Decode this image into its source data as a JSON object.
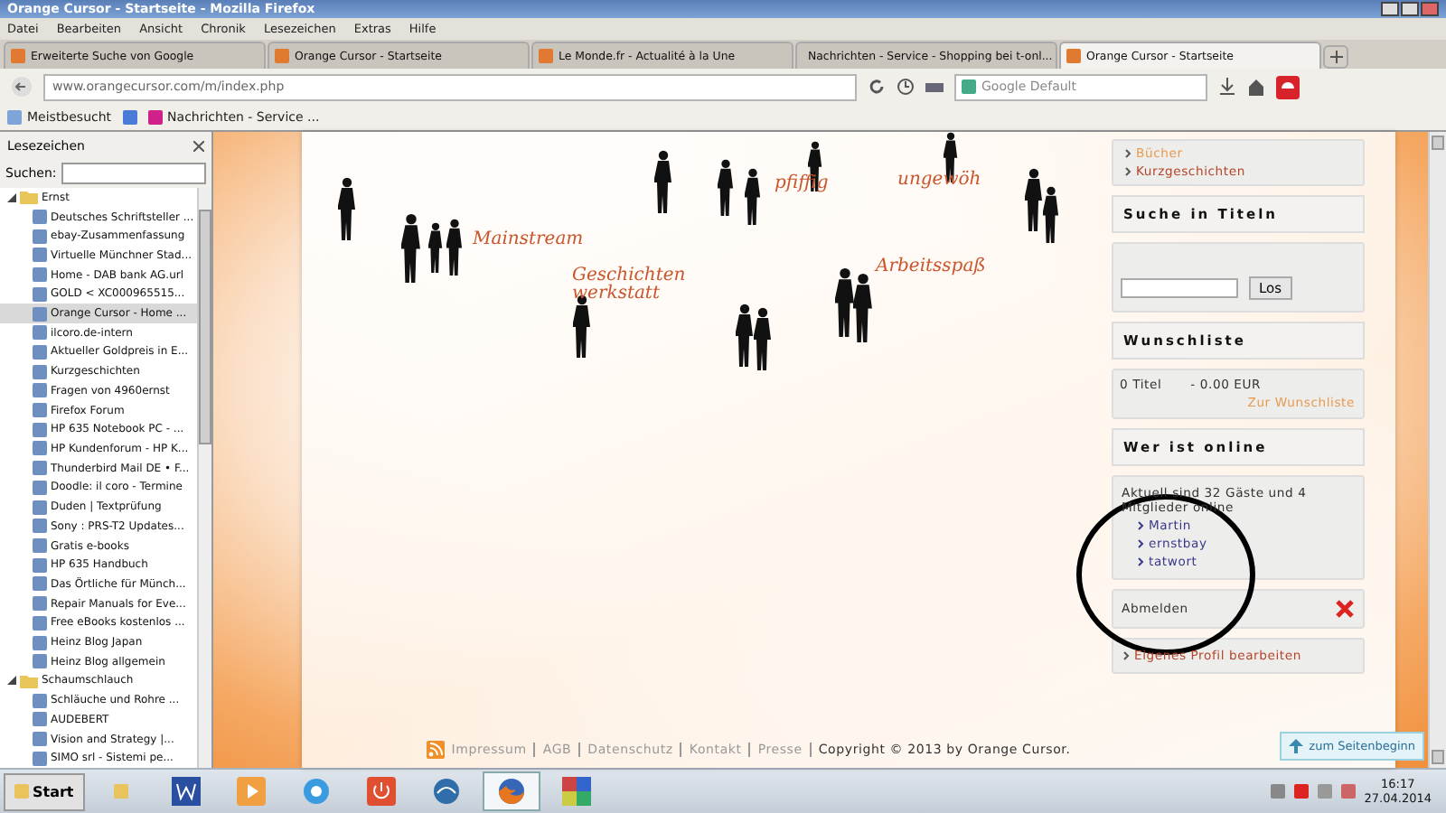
{
  "window": {
    "title": "Orange Cursor - Startseite - Mozilla Firefox"
  },
  "menu": [
    "Datei",
    "Bearbeiten",
    "Ansicht",
    "Chronik",
    "Lesezeichen",
    "Extras",
    "Hilfe"
  ],
  "tabs": [
    {
      "label": "Erweiterte Suche von Google",
      "selected": false
    },
    {
      "label": "Orange Cursor - Startseite",
      "selected": false
    },
    {
      "label": "Le Monde.fr - Actualité à la Une",
      "selected": false
    },
    {
      "label": "Nachrichten - Service - Shopping bei t-onl...",
      "selected": false
    },
    {
      "label": "Orange Cursor - Startseite",
      "selected": true
    }
  ],
  "address": {
    "url": "www.orangecursor.com/m/index.php"
  },
  "search": {
    "placeholder": "Google Default"
  },
  "bookmarks_bar": [
    "Meistbesucht",
    "Nachrichten - Service ..."
  ],
  "sidebar": {
    "title": "Lesezeichen",
    "search_label": "Suchen:",
    "tree": [
      {
        "label": "Ernst",
        "kind": "folder",
        "expanded": true,
        "selected": false,
        "children": [
          {
            "label": "Deutsches Schriftsteller ...",
            "kind": "link",
            "selected": false
          },
          {
            "label": "ebay-Zusammenfassung",
            "kind": "link",
            "selected": false
          },
          {
            "label": "Virtuelle Münchner Stad...",
            "kind": "link",
            "selected": false
          },
          {
            "label": "Home - DAB bank AG.url",
            "kind": "link",
            "selected": false
          },
          {
            "label": "GOLD < XC000965515...",
            "kind": "link",
            "selected": false
          },
          {
            "label": "Orange Cursor - Home ...",
            "kind": "link",
            "selected": true
          },
          {
            "label": "ilcoro.de-intern",
            "kind": "link",
            "selected": false
          },
          {
            "label": "Aktueller Goldpreis in E...",
            "kind": "link",
            "selected": false
          },
          {
            "label": "Kurzgeschichten",
            "kind": "link",
            "selected": false
          },
          {
            "label": "Fragen von 4960ernst",
            "kind": "link",
            "selected": false
          },
          {
            "label": "Firefox Forum",
            "kind": "link",
            "selected": false
          },
          {
            "label": "HP 635 Notebook PC - ...",
            "kind": "link",
            "selected": false
          },
          {
            "label": "HP Kundenforum - HP K...",
            "kind": "link",
            "selected": false
          },
          {
            "label": "Thunderbird Mail DE • F...",
            "kind": "link",
            "selected": false
          },
          {
            "label": "Doodle: il coro - Termine",
            "kind": "link",
            "selected": false
          },
          {
            "label": "Duden | Textprüfung",
            "kind": "link",
            "selected": false
          },
          {
            "label": "Sony : PRS-T2 Updates...",
            "kind": "link",
            "selected": false
          },
          {
            "label": "Gratis e-books",
            "kind": "link",
            "selected": false
          },
          {
            "label": "HP 635 Handbuch",
            "kind": "link",
            "selected": false
          },
          {
            "label": "Das Örtliche für Münch...",
            "kind": "link",
            "selected": false
          },
          {
            "label": "Repair Manuals for Eve...",
            "kind": "link",
            "selected": false
          },
          {
            "label": "Free eBooks kostenlos ...",
            "kind": "link",
            "selected": false
          },
          {
            "label": "Heinz Blog Japan",
            "kind": "link",
            "selected": false
          },
          {
            "label": "Heinz Blog allgemein",
            "kind": "link",
            "selected": false
          }
        ]
      },
      {
        "label": "Schaumschlauch",
        "kind": "folder",
        "expanded": true,
        "selected": false,
        "children": [
          {
            "label": "Schläuche und Rohre ...",
            "kind": "link",
            "selected": false
          },
          {
            "label": "AUDEBERT",
            "kind": "link",
            "selected": false
          },
          {
            "label": "Vision and Strategy |...",
            "kind": "link",
            "selected": false
          },
          {
            "label": "SIMO srl - Sistemi pe...",
            "kind": "link",
            "selected": false
          }
        ]
      }
    ]
  },
  "banner": {
    "labels": [
      "pfiffig",
      "ungewöh",
      "Mainstream",
      "Geschichten werkstatt",
      "Arbeitsspaß"
    ]
  },
  "right_column": {
    "categories": [
      "Bücher",
      "Kurzgeschichten"
    ],
    "title_search": {
      "title": "Suche in Titeln",
      "button": "Los"
    },
    "wishlist": {
      "title": "Wunschliste",
      "count": "0 Titel",
      "amount": "-  0.00 EUR",
      "link": "Zur Wunschliste"
    },
    "online": {
      "title": "Wer ist online",
      "text": "Aktuell sind 32 Gäste und 4 Mitglieder online",
      "members": [
        "Martin",
        "ernstbay",
        "tatwort"
      ]
    },
    "logout": "Abmelden",
    "edit_profile": "Eigenes Profil bearbeiten"
  },
  "footer": {
    "links": [
      "Impressum",
      "AGB",
      "Datenschutz",
      "Kontakt",
      "Presse"
    ],
    "copyright": "Copyright © 2013 by Orange Cursor."
  },
  "back_to_top": "zum Seitenbeginn",
  "taskbar": {
    "start": "Start",
    "apps": [
      {
        "kind": "folder",
        "selected": false
      },
      {
        "kind": "word",
        "selected": false
      },
      {
        "kind": "media",
        "selected": false
      },
      {
        "kind": "ie",
        "selected": false
      },
      {
        "kind": "power",
        "selected": false
      },
      {
        "kind": "thunderbird",
        "selected": false
      },
      {
        "kind": "firefox",
        "selected": true
      },
      {
        "kind": "tool",
        "selected": false
      }
    ],
    "time": "16:17",
    "date": "27.04.2014"
  }
}
